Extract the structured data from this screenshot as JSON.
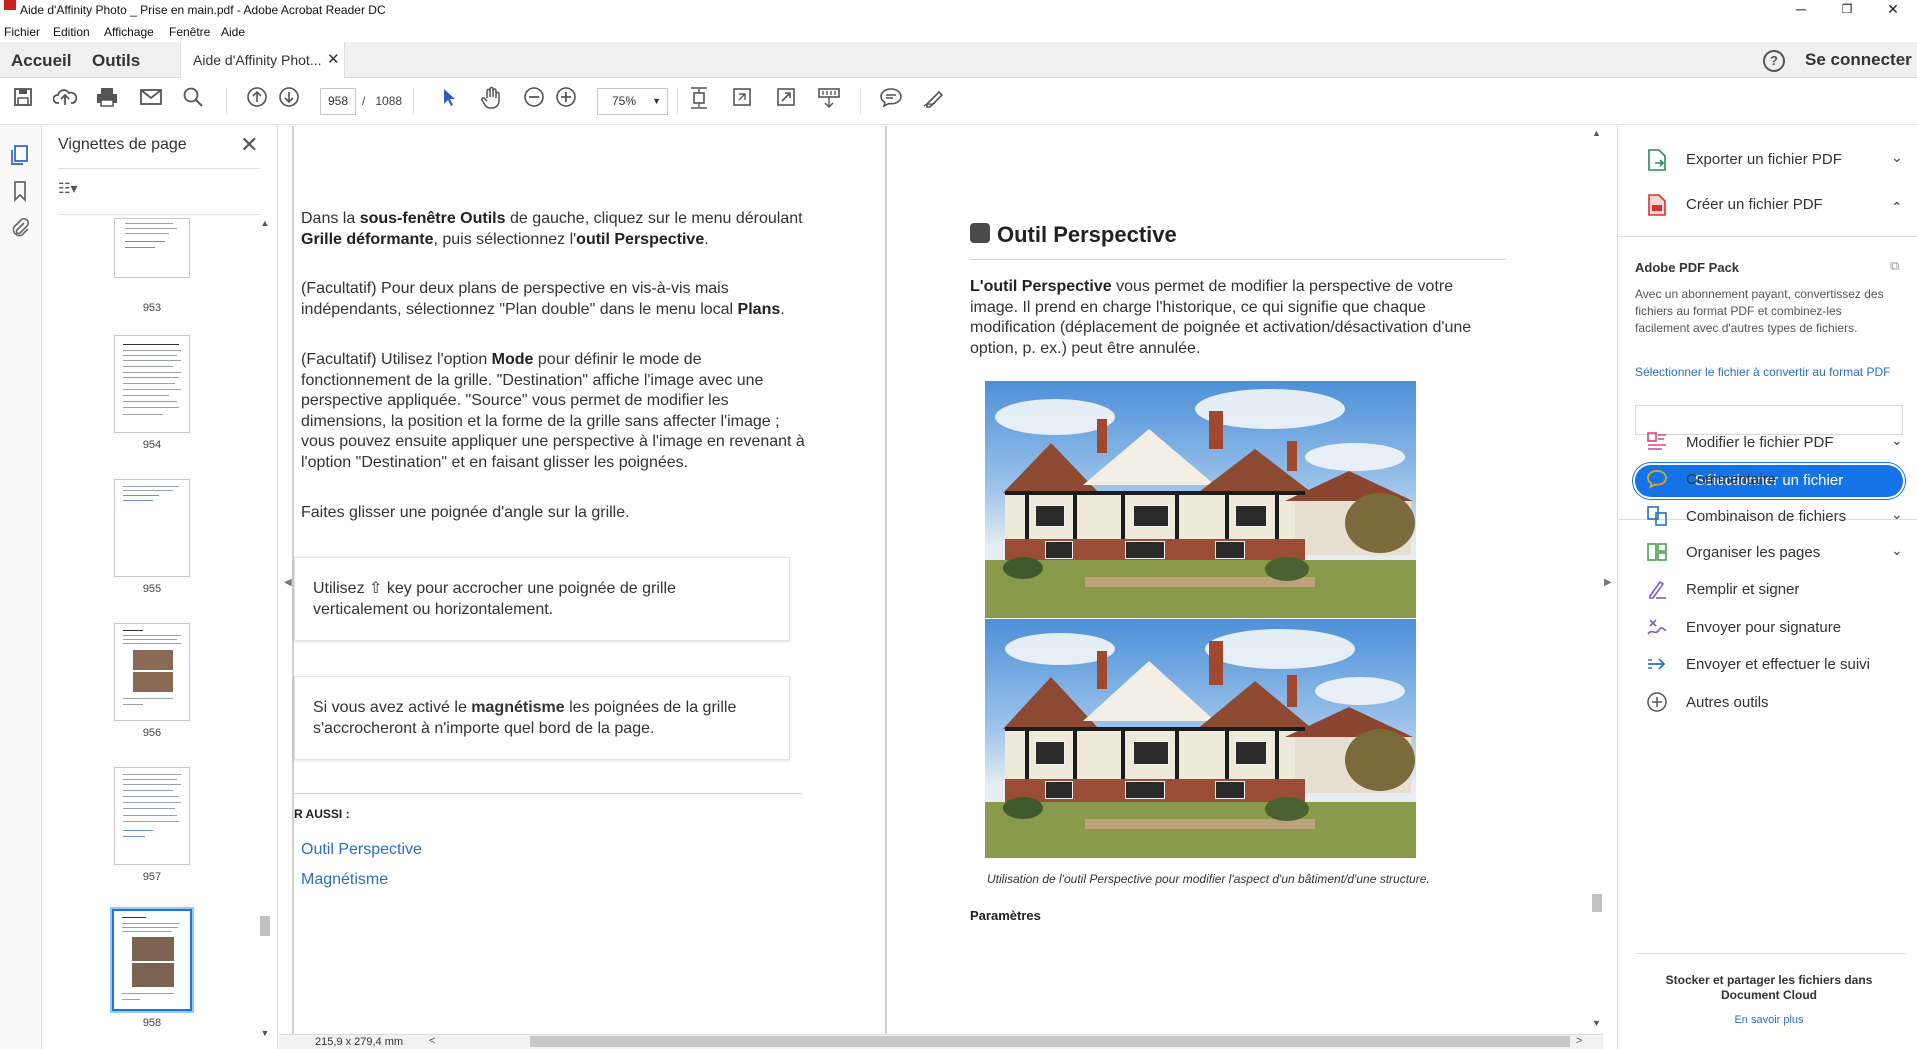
{
  "window": {
    "title": "Aide d'Affinity Photo _ Prise en main.pdf - Adobe Acrobat Reader DC",
    "minimize": "─",
    "restore": "❐",
    "close": "✕"
  },
  "menu": [
    "Fichier",
    "Edition",
    "Affichage",
    "Fenêtre",
    "Aide"
  ],
  "tabs": {
    "home": "Accueil",
    "tools": "Outils",
    "document": "Aide d'Affinity Phot...",
    "document_close": "✕",
    "help": "?",
    "connect": "Se connecter"
  },
  "toolbar": {
    "current_page": "958",
    "page_separator": "/",
    "total_pages": "1088",
    "zoom": "75%",
    "icons": [
      "save-icon",
      "upload-icon",
      "print-icon",
      "email-icon",
      "search-icon",
      "prev-page-icon",
      "next-page-icon",
      "select-icon",
      "hand-icon",
      "zoom-out-icon",
      "zoom-in-icon",
      "fit-page-icon",
      "rotate-icon",
      "fullscreen-icon",
      "scroll-mode-icon",
      "comment-icon",
      "sign-icon"
    ]
  },
  "thumbnails": {
    "title": "Vignettes de page",
    "close": "✕",
    "pages": [
      "953",
      "954",
      "955",
      "956",
      "957",
      "958"
    ],
    "selected": "958"
  },
  "doc": {
    "left_paragraphs": [
      {
        "parts": [
          [
            "Dans la ",
            false
          ],
          [
            "sous-fenêtre Outils",
            true
          ],
          [
            " de gauche, cliquez sur le menu déroulant ",
            false
          ],
          [
            "Grille déformante",
            true
          ],
          [
            ", puis sélectionnez l'",
            false
          ],
          [
            "outil Perspective",
            true
          ],
          [
            ".",
            false
          ]
        ]
      },
      {
        "parts": [
          [
            "(Facultatif) Pour deux plans de perspective en vis-à-vis mais indépendants, sélectionnez \"Plan double\" dans le menu local ",
            false
          ],
          [
            "Plans",
            true
          ],
          [
            ".",
            false
          ]
        ]
      },
      {
        "parts": [
          [
            "(Facultatif) Utilisez l'option ",
            false
          ],
          [
            "Mode",
            true
          ],
          [
            " pour définir le mode de fonctionnement de la grille. \"Destination\" affiche l'image avec une perspective appliquée. \"Source\" vous permet de modifier les dimensions, la position et la forme de la grille sans affecter l'image ; vous pouvez ensuite appliquer une perspective à l'image en revenant à l'option \"Destination\" et en faisant glisser les poignées.",
            false
          ]
        ]
      },
      {
        "parts": [
          [
            "Faites glisser une poignée d'angle sur la grille.",
            false
          ]
        ]
      }
    ],
    "callout1": "Utilisez ⇧ key pour accrocher une poignée de grille verticalement ou horizontalement.",
    "callout2_parts": [
      [
        "Si vous avez activé le ",
        false
      ],
      [
        "magnétisme",
        true
      ],
      [
        " les poignées de la grille s'accrocheront à n'importe quel bord de la page.",
        false
      ]
    ],
    "see_also": "R AUSSI :",
    "links": [
      "Outil Perspective",
      "Magnétisme"
    ],
    "heading": "Outil Perspective",
    "intro_parts": [
      [
        "L'outil Perspective",
        true
      ],
      [
        " vous permet de modifier la perspective de votre image. Il prend en charge l'historique, ce qui signifie que chaque modification (déplacement de poignée et activation/désactivation d'une option, p. ex.) peut être annulée.",
        false
      ]
    ],
    "caption": "Utilisation de l'outil Perspective pour modifier l'aspect d'un bâtiment/d'une structure.",
    "params": "Paramètres",
    "page_size": "215,9 x 279,4 mm"
  },
  "right_panel": {
    "export": "Exporter un fichier PDF",
    "create": "Créer un fichier PDF",
    "pack_title": "Adobe PDF Pack",
    "pack_desc": "Avec un abonnement payant, convertissez des fichiers au format PDF et combinez-les facilement avec d'autres types de fichiers.",
    "pack_link": "Sélectionner le fichier à convertir au format PDF",
    "pack_button": "Sélectionner un fichier",
    "tools": [
      {
        "label": "Modifier le fichier PDF",
        "icon": "edit-pdf-icon",
        "chevron": true,
        "color": "#d8448b"
      },
      {
        "label": "Commentaire",
        "icon": "comment-icon",
        "chevron": false,
        "color": "#e8a617"
      },
      {
        "label": "Combinaison de fichiers",
        "icon": "combine-files-icon",
        "chevron": true,
        "color": "#2a6ec7"
      },
      {
        "label": "Organiser les pages",
        "icon": "organize-pages-icon",
        "chevron": true,
        "color": "#48a04a"
      },
      {
        "label": "Remplir et signer",
        "icon": "fill-sign-icon",
        "chevron": false,
        "color": "#7a5bd1"
      },
      {
        "label": "Envoyer pour signature",
        "icon": "send-signature-icon",
        "chevron": false,
        "color": "#7a5bd1"
      },
      {
        "label": "Envoyer et effectuer le suivi",
        "icon": "send-track-icon",
        "chevron": false,
        "color": "#2a6ec7"
      },
      {
        "label": "Autres outils",
        "icon": "more-tools-icon",
        "chevron": false,
        "color": "#555555"
      }
    ],
    "dc_title": "Stocker et partager les fichiers dans Document Cloud",
    "dc_link": "En savoir plus"
  }
}
